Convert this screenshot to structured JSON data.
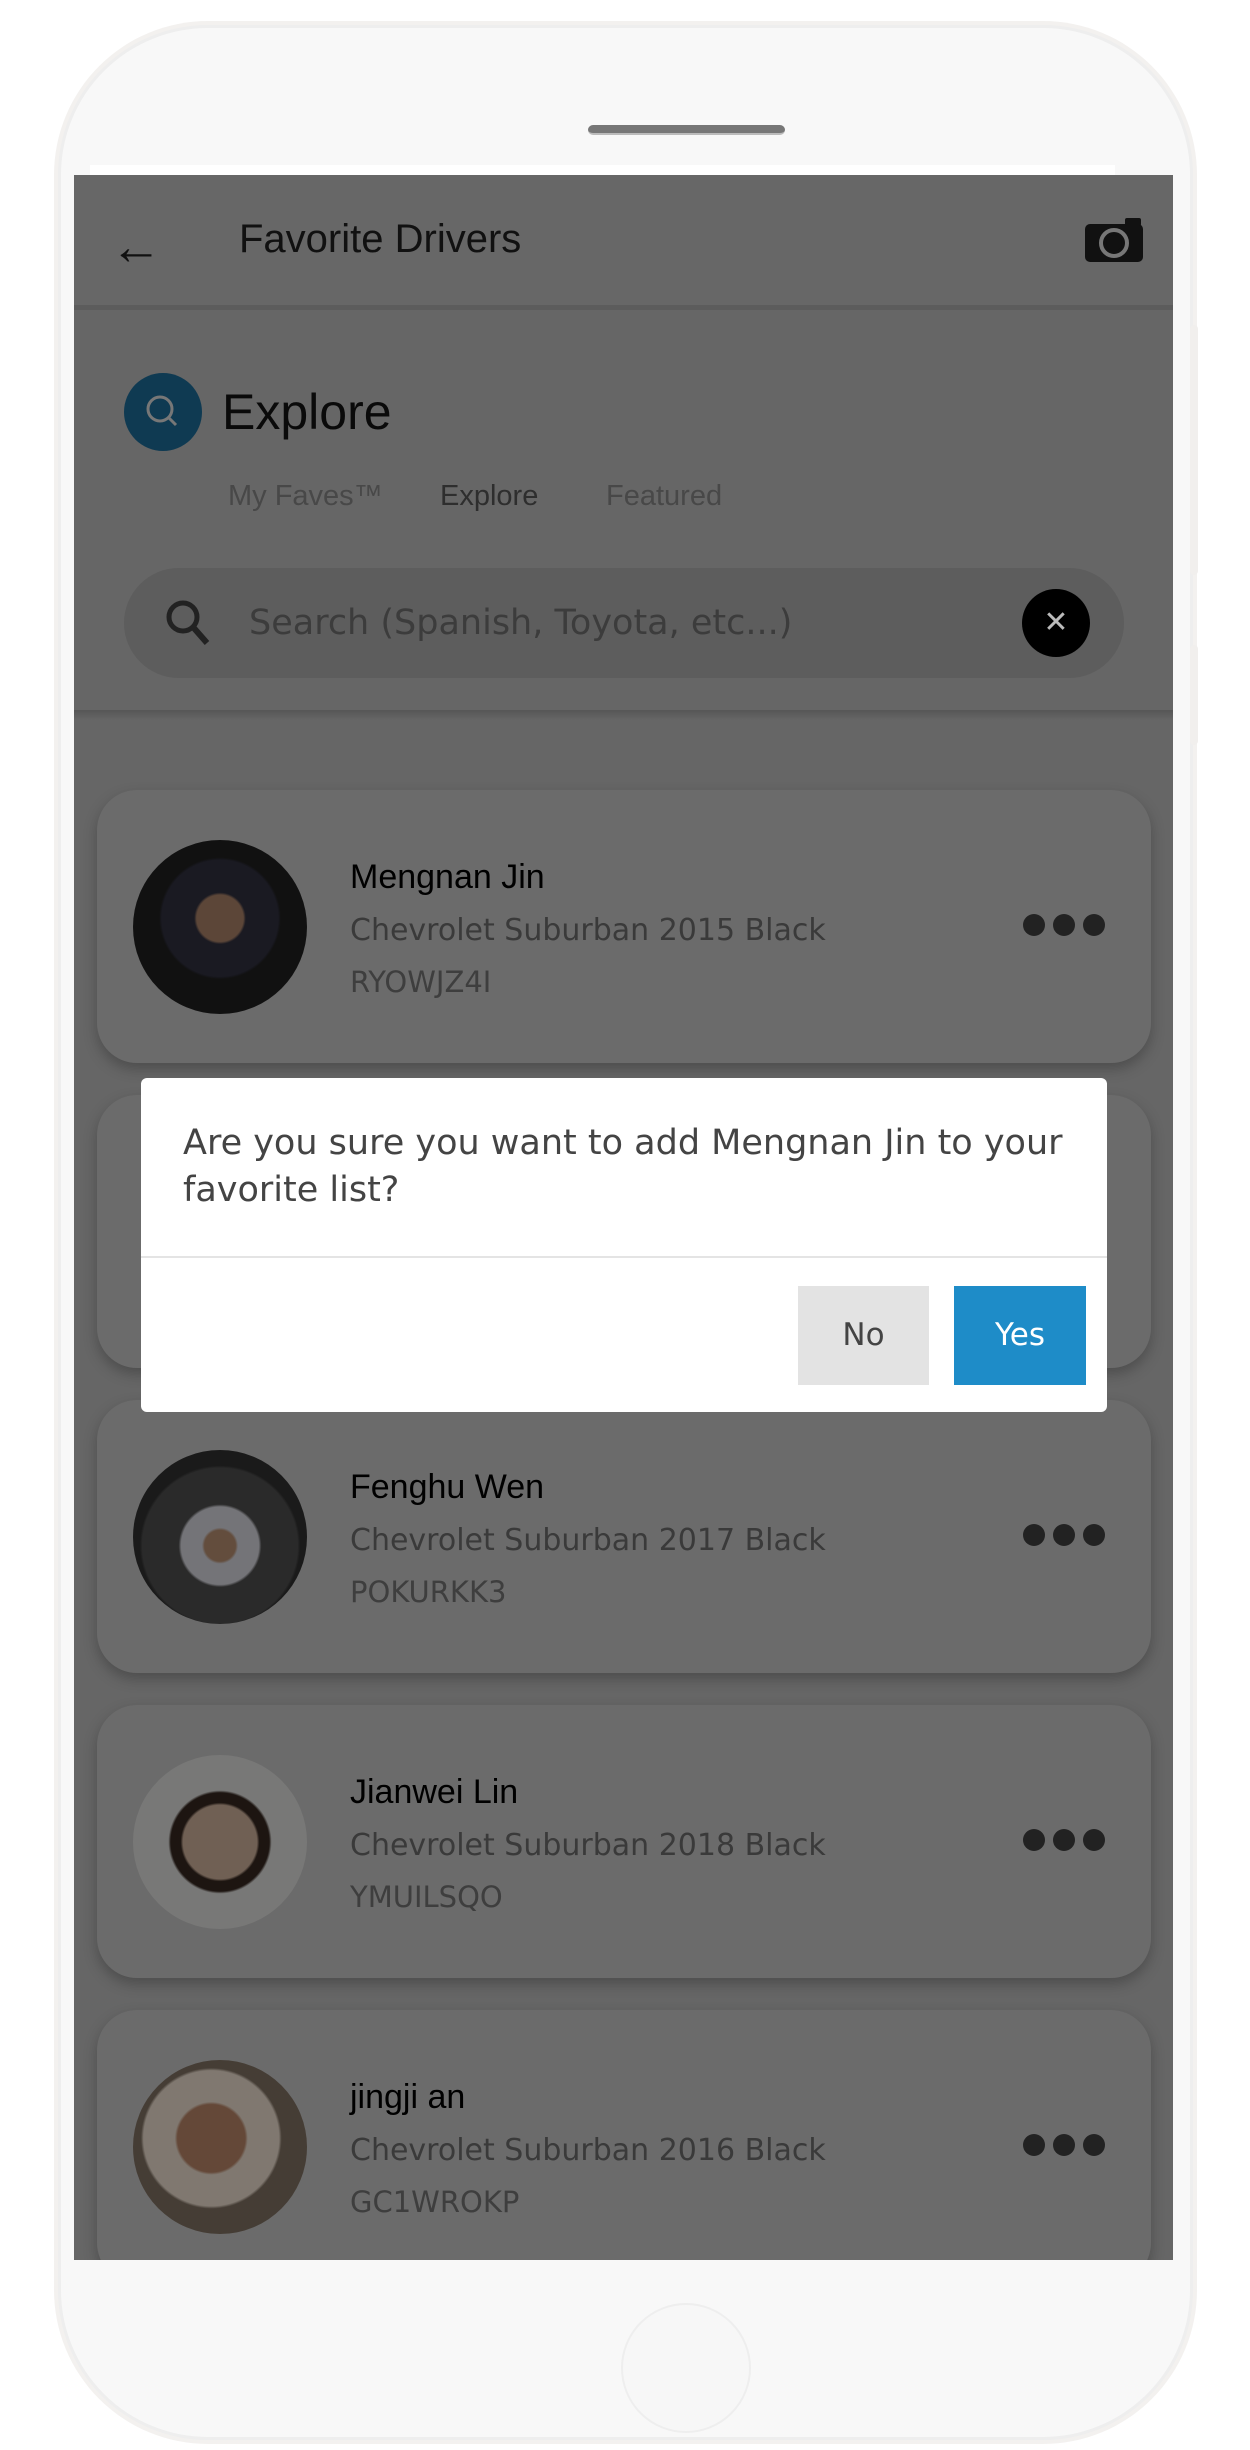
{
  "header": {
    "title": "Favorite Drivers"
  },
  "explore": {
    "heading": "Explore"
  },
  "tabs": [
    {
      "label": "My Faves™"
    },
    {
      "label": "Explore"
    },
    {
      "label": "Featured"
    }
  ],
  "search": {
    "placeholder": "Search (Spanish, Toyota, etc...)",
    "value": ""
  },
  "drivers": [
    {
      "name": "Mengnan Jin",
      "car": "Chevrolet Suburban 2015 Black",
      "code": "RYOWJZ4I"
    },
    {
      "name": "",
      "car": "",
      "code": ""
    },
    {
      "name": "Fenghu Wen",
      "car": "Chevrolet Suburban 2017 Black",
      "code": "POKURKK3"
    },
    {
      "name": "Jianwei Lin",
      "car": "Chevrolet Suburban 2018 Black",
      "code": "YMUILSQO"
    },
    {
      "name": "jingji an",
      "car": "Chevrolet Suburban 2016 Black",
      "code": "GC1WROKP"
    }
  ],
  "dialog": {
    "message": "Are you sure you want to add Mengnan Jin to your favorite list?",
    "no_label": "No",
    "yes_label": "Yes"
  },
  "colors": {
    "accent": "#1e8cc8"
  }
}
